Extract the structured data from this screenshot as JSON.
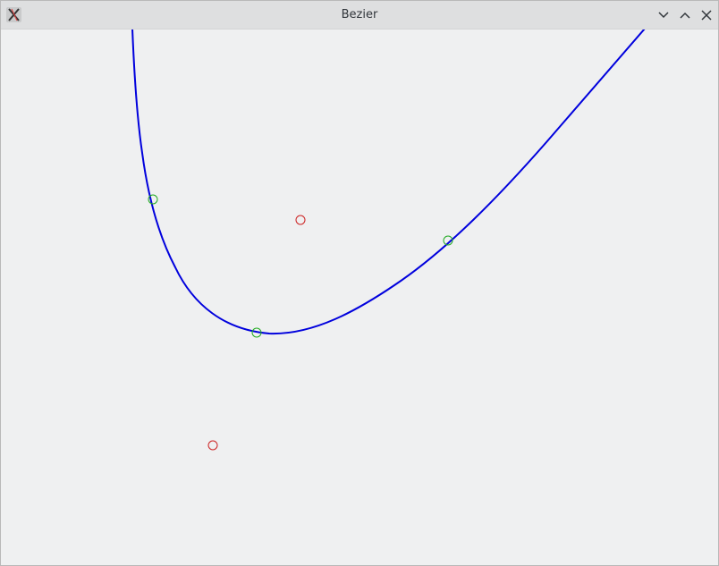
{
  "window": {
    "title": "Bezier",
    "buttons": [
      "minimize",
      "maximize",
      "close"
    ]
  },
  "scene": {
    "curve_color": "#0000dd",
    "control_point_color": "#cc2222",
    "curve_point_color": "#22aa22",
    "background": "#eff0f1"
  }
}
